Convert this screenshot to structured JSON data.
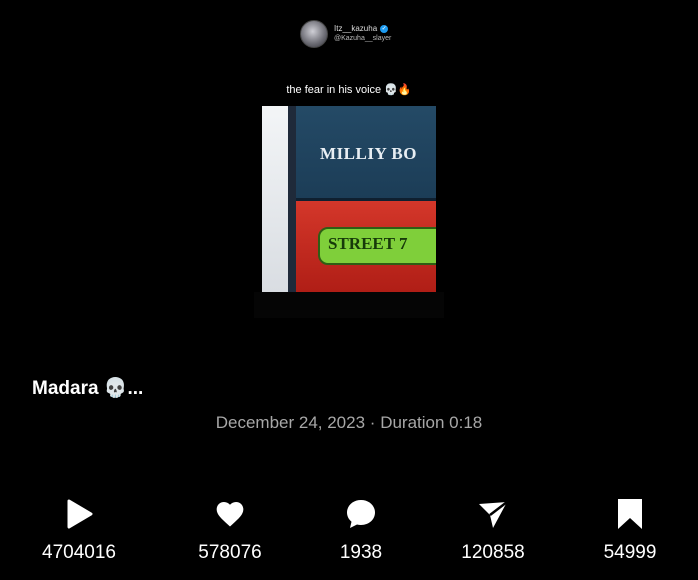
{
  "author": {
    "username": "Itz__kazuha",
    "handle": "@Kazuha__slayer"
  },
  "caption": "the fear in his voice 💀🔥",
  "video_text": {
    "sign_top": "MILLIY BO",
    "sign_bottom": "STREET 7"
  },
  "title": "Madara 💀...",
  "date": "December 24, 2023",
  "duration": "Duration 0:18",
  "stats": {
    "plays": "4704016",
    "likes": "578076",
    "comments": "1938",
    "shares": "120858",
    "saves": "54999"
  },
  "colors": {
    "background": "#000000",
    "verified": "#1d9bf0",
    "meta_text": "#a7a7a7"
  }
}
